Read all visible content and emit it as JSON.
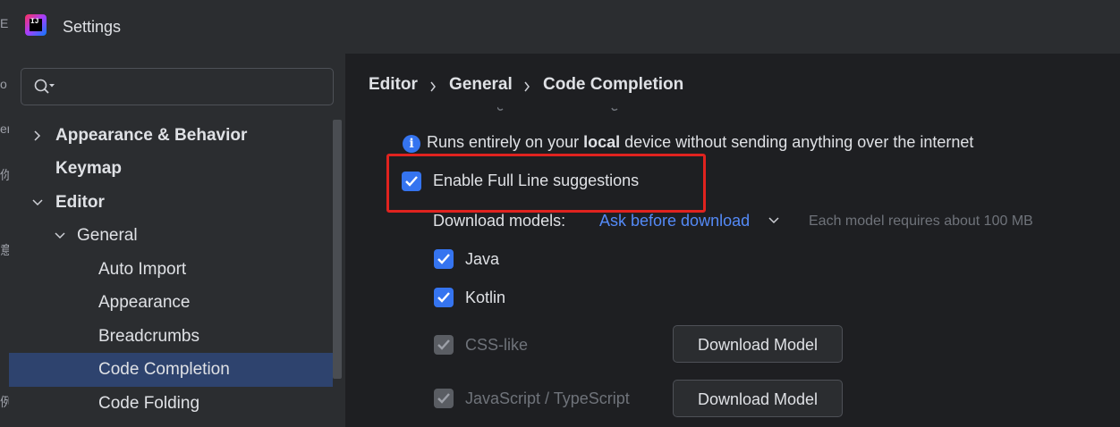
{
  "edge": {
    "chars": [
      "E",
      "o",
      "er",
      "你",
      "意",
      "例"
    ]
  },
  "window": {
    "title": "Settings",
    "app_logo_text": "IJ"
  },
  "sidebar": {
    "search_placeholder": "",
    "items": [
      {
        "label": "Appearance & Behavior",
        "expanded": false
      },
      {
        "label": "Keymap"
      },
      {
        "label": "Editor",
        "expanded": true
      },
      {
        "label": "General",
        "expanded": true
      },
      {
        "label": "Auto Import"
      },
      {
        "label": "Appearance"
      },
      {
        "label": "Breadcrumbs"
      },
      {
        "label": "Code Completion",
        "selected": true
      },
      {
        "label": "Code Folding"
      }
    ]
  },
  "breadcrumb": [
    "Editor",
    "General",
    "Code Completion"
  ],
  "content": {
    "info_prefix": "Runs entirely on your ",
    "info_bold": "local",
    "info_suffix": " device without sending anything over the internet",
    "enable_full_line": {
      "label": "Enable Full Line suggestions",
      "checked": true
    },
    "download_models_label": "Download models:",
    "download_models_value": "Ask before download",
    "download_hint": "Each model requires about 100 MB",
    "languages": [
      {
        "label": "Java",
        "checked": true,
        "enabled": true
      },
      {
        "label": "Kotlin",
        "checked": true,
        "enabled": true
      },
      {
        "label": "CSS-like",
        "checked": true,
        "enabled": false,
        "button": "Download Model"
      },
      {
        "label": "JavaScript / TypeScript",
        "checked": true,
        "enabled": false,
        "button": "Download Model"
      }
    ]
  },
  "colors": {
    "accent": "#3574f0",
    "link": "#548af7",
    "highlight_box": "#e0231f",
    "selection": "#2e436e"
  }
}
